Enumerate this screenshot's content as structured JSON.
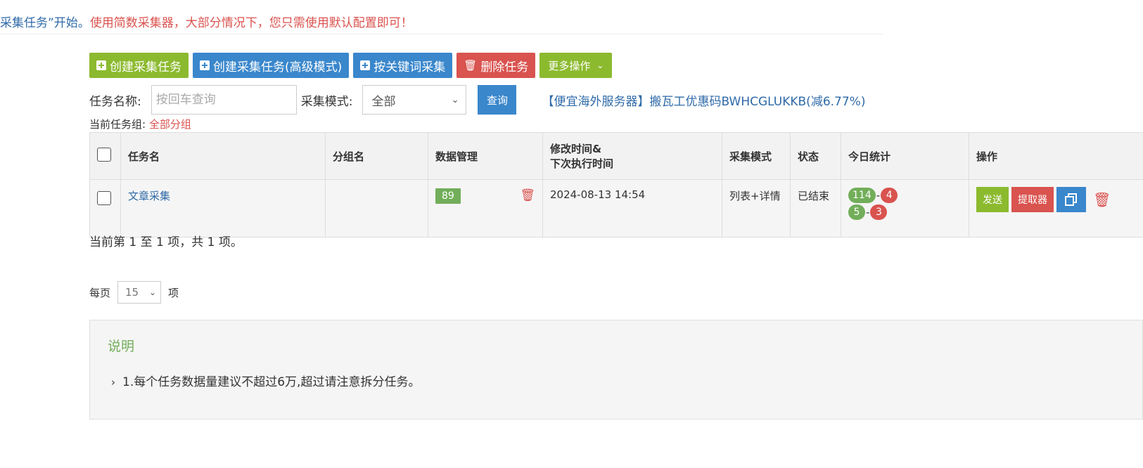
{
  "notice": {
    "part1": "采集任务”开始。",
    "part2": "使用简数采集器，大部分情况下，您只需使用默认配置即可！"
  },
  "toolbar": {
    "create_label": "创建采集任务",
    "create_advanced_label": "创建采集任务(高级模式)",
    "keyword_label": "按关键词采集",
    "delete_label": "删除任务",
    "more_label": "更多操作"
  },
  "search": {
    "name_label": "任务名称:",
    "name_placeholder": "按回车查询",
    "mode_label": "采集模式:",
    "mode_value": "全部",
    "query_label": "查询",
    "promo_text": "【便宜海外服务器】搬瓦工优惠码BWHCGLUKKB(减6.77%)"
  },
  "group": {
    "label": "当前任务组:",
    "value": "全部分组"
  },
  "table": {
    "headers": {
      "name": "任务名",
      "group": "分组名",
      "data": "数据管理",
      "time_line1": "修改时间&",
      "time_line2": "下次执行时间",
      "mode": "采集模式",
      "status": "状态",
      "stats": "今日统计",
      "ops": "操作"
    },
    "rows": [
      {
        "name": "文章采集",
        "group": "",
        "data_count": "89",
        "time": "2024-08-13 14:54",
        "mode": "列表+详情",
        "status": "已结束",
        "stats": {
          "a1": "114",
          "a2": "4",
          "b1": "5",
          "b2": "3"
        },
        "send_label": "发送",
        "extract_label": "提取器"
      }
    ]
  },
  "pager": {
    "info": "当前第 1 至 1 项，共 1 项。",
    "per_page_label": "每页",
    "per_page_value": "15",
    "items_label": "项"
  },
  "note": {
    "title": "说明",
    "item1": "1.每个任务数据量建议不超过6万,超过请注意拆分任务。"
  },
  "colors": {
    "green": "#8cba2f",
    "blue": "#3a87cc",
    "red": "#d9534f",
    "badge_green": "#72ae5a",
    "link_blue": "#2f6aa8"
  },
  "icons": {
    "plus": "plus-square-icon",
    "trash": "trash-icon",
    "chevron": "chevron-down-icon",
    "copy": "copy-icon"
  }
}
